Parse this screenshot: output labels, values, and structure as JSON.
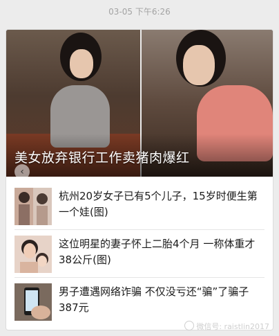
{
  "chat": {
    "timestamp": "03-05 下午6:26"
  },
  "news_card": {
    "hero": {
      "title": "美女放弃银行工作卖猪肉爆红",
      "nav_icon": "chevron-left-icon"
    },
    "items": [
      {
        "text": "杭州20岁女子已有5个儿子，15岁时便生第一个娃(图)"
      },
      {
        "text": "这位明星的妻子怀上二胎4个月 一称体重才38公斤(图)"
      },
      {
        "text": "男子遭遇网络诈骗 不仅没亏还“骗”了骗子387元"
      }
    ]
  },
  "watermark": {
    "text": "微信号: raistlin2017"
  }
}
